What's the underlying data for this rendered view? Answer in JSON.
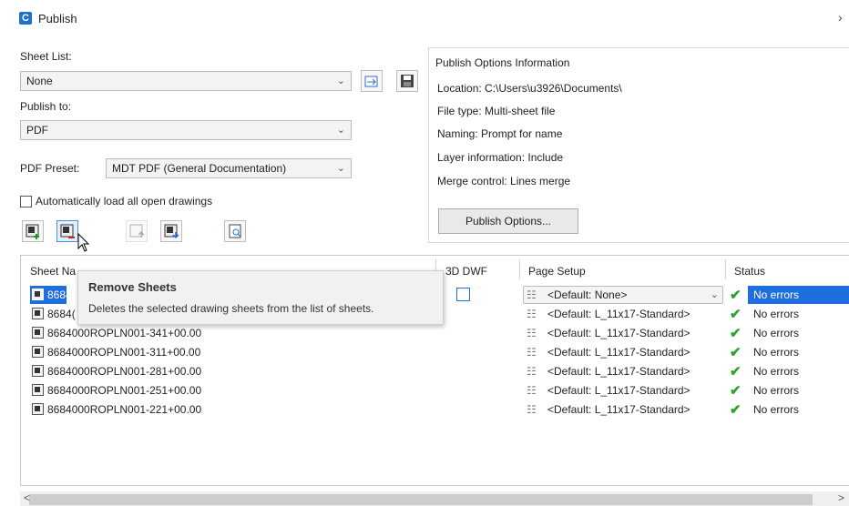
{
  "window": {
    "title": "Publish",
    "close_glyph": "›"
  },
  "sheet_list": {
    "label": "Sheet List:",
    "value": "None"
  },
  "publish_to": {
    "label": "Publish to:",
    "value": "PDF"
  },
  "pdf_preset": {
    "label": "PDF Preset:",
    "value": "MDT PDF (General Documentation)"
  },
  "auto_load": {
    "label": "Automatically load all open drawings",
    "checked": false
  },
  "info": {
    "title": "Publish Options Information",
    "location": "Location: C:\\Users\\u3926\\Documents\\",
    "file_type": "File type: Multi-sheet file",
    "naming": "Naming: Prompt for name",
    "layer": "Layer information: Include",
    "merge": "Merge control: Lines merge",
    "button": "Publish Options..."
  },
  "grid": {
    "headers": {
      "sheet_name": "Sheet Na",
      "dwf3d": "3D DWF",
      "page_setup": "Page Setup",
      "status": "Status"
    },
    "rows": [
      {
        "name": "8684(",
        "page_setup": "<Default: None>",
        "status": "No errors"
      },
      {
        "name": "8684(",
        "page_setup": "<Default: L_11x17-Standard>",
        "status": "No errors"
      },
      {
        "name": "8684000ROPLN001-341+00.00",
        "page_setup": "<Default: L_11x17-Standard>",
        "status": "No errors"
      },
      {
        "name": "8684000ROPLN001-311+00.00",
        "page_setup": "<Default: L_11x17-Standard>",
        "status": "No errors"
      },
      {
        "name": "8684000ROPLN001-281+00.00",
        "page_setup": "<Default: L_11x17-Standard>",
        "status": "No errors"
      },
      {
        "name": "8684000ROPLN001-251+00.00",
        "page_setup": "<Default: L_11x17-Standard>",
        "status": "No errors"
      },
      {
        "name": "8684000ROPLN001-221+00.00",
        "page_setup": "<Default: L_11x17-Standard>",
        "status": "No errors"
      }
    ]
  },
  "tooltip": {
    "title": "Remove Sheets",
    "text": "Deletes the selected drawing sheets from the list of sheets."
  },
  "scroll": {
    "left": "<",
    "right": ">"
  },
  "colors": {
    "selection": "#1e6ee0",
    "check": "#2aa32a",
    "accent": "#1f6fd1"
  }
}
